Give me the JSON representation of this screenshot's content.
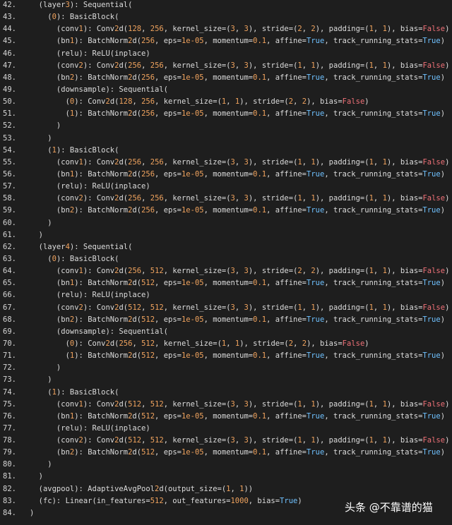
{
  "colors": {
    "background": "#1e1e1e",
    "text": "#dcdcdc",
    "number": "#f0a35e",
    "false_literal": "#f07178",
    "true_literal": "#6fc1ff"
  },
  "watermark": "头条 @不靠谱的猫",
  "lines": [
    {
      "n": "42.",
      "t": "  (layer3): Sequential("
    },
    {
      "n": "43.",
      "t": "    (0): BasicBlock("
    },
    {
      "n": "44.",
      "t": "      (conv1): Conv2d(128, 256, kernel_size=(3, 3), stride=(2, 2), padding=(1, 1), bias=False)"
    },
    {
      "n": "45.",
      "t": "      (bn1): BatchNorm2d(256, eps=1e-05, momentum=0.1, affine=True, track_running_stats=True)"
    },
    {
      "n": "46.",
      "t": "      (relu): ReLU(inplace)"
    },
    {
      "n": "47.",
      "t": "      (conv2): Conv2d(256, 256, kernel_size=(3, 3), stride=(1, 1), padding=(1, 1), bias=False)"
    },
    {
      "n": "48.",
      "t": "      (bn2): BatchNorm2d(256, eps=1e-05, momentum=0.1, affine=True, track_running_stats=True)"
    },
    {
      "n": "49.",
      "t": "      (downsample): Sequential("
    },
    {
      "n": "50.",
      "t": "        (0): Conv2d(128, 256, kernel_size=(1, 1), stride=(2, 2), bias=False)"
    },
    {
      "n": "51.",
      "t": "        (1): BatchNorm2d(256, eps=1e-05, momentum=0.1, affine=True, track_running_stats=True)"
    },
    {
      "n": "52.",
      "t": "      )"
    },
    {
      "n": "53.",
      "t": "    )"
    },
    {
      "n": "54.",
      "t": "    (1): BasicBlock("
    },
    {
      "n": "55.",
      "t": "      (conv1): Conv2d(256, 256, kernel_size=(3, 3), stride=(1, 1), padding=(1, 1), bias=False)"
    },
    {
      "n": "56.",
      "t": "      (bn1): BatchNorm2d(256, eps=1e-05, momentum=0.1, affine=True, track_running_stats=True)"
    },
    {
      "n": "57.",
      "t": "      (relu): ReLU(inplace)"
    },
    {
      "n": "58.",
      "t": "      (conv2): Conv2d(256, 256, kernel_size=(3, 3), stride=(1, 1), padding=(1, 1), bias=False)"
    },
    {
      "n": "59.",
      "t": "      (bn2): BatchNorm2d(256, eps=1e-05, momentum=0.1, affine=True, track_running_stats=True)"
    },
    {
      "n": "60.",
      "t": "    )"
    },
    {
      "n": "61.",
      "t": "  )"
    },
    {
      "n": "62.",
      "t": "  (layer4): Sequential("
    },
    {
      "n": "63.",
      "t": "    (0): BasicBlock("
    },
    {
      "n": "64.",
      "t": "      (conv1): Conv2d(256, 512, kernel_size=(3, 3), stride=(2, 2), padding=(1, 1), bias=False)"
    },
    {
      "n": "65.",
      "t": "      (bn1): BatchNorm2d(512, eps=1e-05, momentum=0.1, affine=True, track_running_stats=True)"
    },
    {
      "n": "66.",
      "t": "      (relu): ReLU(inplace)"
    },
    {
      "n": "67.",
      "t": "      (conv2): Conv2d(512, 512, kernel_size=(3, 3), stride=(1, 1), padding=(1, 1), bias=False)"
    },
    {
      "n": "68.",
      "t": "      (bn2): BatchNorm2d(512, eps=1e-05, momentum=0.1, affine=True, track_running_stats=True)"
    },
    {
      "n": "69.",
      "t": "      (downsample): Sequential("
    },
    {
      "n": "70.",
      "t": "        (0): Conv2d(256, 512, kernel_size=(1, 1), stride=(2, 2), bias=False)"
    },
    {
      "n": "71.",
      "t": "        (1): BatchNorm2d(512, eps=1e-05, momentum=0.1, affine=True, track_running_stats=True)"
    },
    {
      "n": "72.",
      "t": "      )"
    },
    {
      "n": "73.",
      "t": "    )"
    },
    {
      "n": "74.",
      "t": "    (1): BasicBlock("
    },
    {
      "n": "75.",
      "t": "      (conv1): Conv2d(512, 512, kernel_size=(3, 3), stride=(1, 1), padding=(1, 1), bias=False)"
    },
    {
      "n": "76.",
      "t": "      (bn1): BatchNorm2d(512, eps=1e-05, momentum=0.1, affine=True, track_running_stats=True)"
    },
    {
      "n": "77.",
      "t": "      (relu): ReLU(inplace)"
    },
    {
      "n": "78.",
      "t": "      (conv2): Conv2d(512, 512, kernel_size=(3, 3), stride=(1, 1), padding=(1, 1), bias=False)"
    },
    {
      "n": "79.",
      "t": "      (bn2): BatchNorm2d(512, eps=1e-05, momentum=0.1, affine=True, track_running_stats=True)"
    },
    {
      "n": "80.",
      "t": "    )"
    },
    {
      "n": "81.",
      "t": "  )"
    },
    {
      "n": "82.",
      "t": "  (avgpool): AdaptiveAvgPool2d(output_size=(1, 1))"
    },
    {
      "n": "83.",
      "t": "  (fc): Linear(in_features=512, out_features=1000, bias=True)"
    },
    {
      "n": "84.",
      "t": ")"
    }
  ]
}
